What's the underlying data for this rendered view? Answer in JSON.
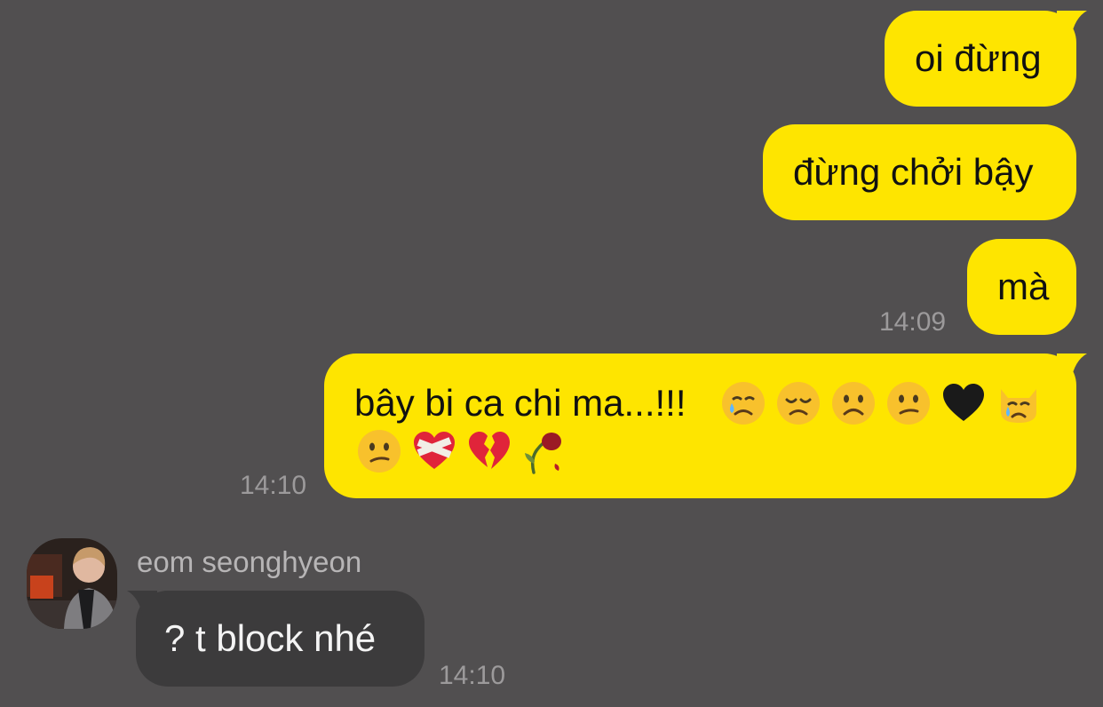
{
  "colors": {
    "background": "#514f50",
    "outgoing_bubble": "#fee500",
    "incoming_bubble": "#3c3b3c",
    "timestamp": "#9c9a9b"
  },
  "messages": {
    "m1": {
      "text": "oi đừng"
    },
    "m2": {
      "text": "đừng chởi bậy"
    },
    "m3": {
      "text": "mà",
      "time": "14:09"
    },
    "m4": {
      "text": "bây bi ca chi ma...!!!",
      "emojis": [
        "crying-face",
        "disappointed-face",
        "frowning-face",
        "confused-face",
        "black-heart",
        "crying-cat",
        "confused-face",
        "mending-heart",
        "broken-heart",
        "wilted-flower"
      ],
      "time": "14:10"
    },
    "m5": {
      "sender": "eom seonghyeon",
      "text": "? t block nhé",
      "time": "14:10"
    }
  }
}
